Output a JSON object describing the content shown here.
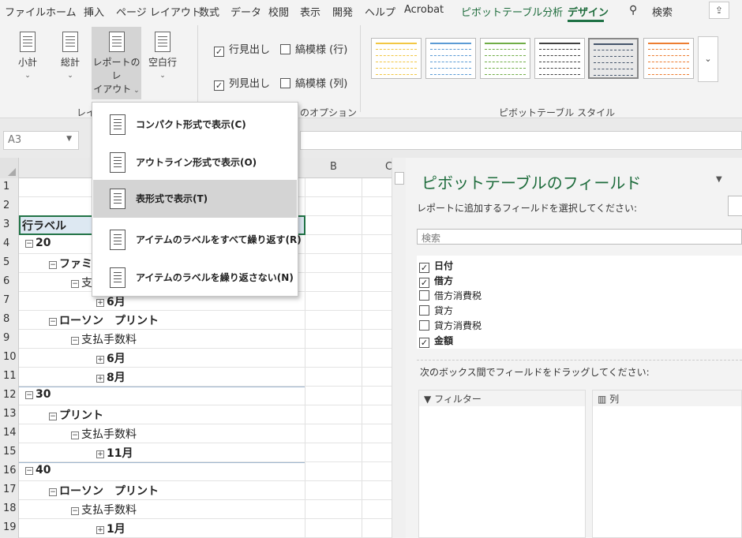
{
  "menubar": {
    "tabs": [
      "ファイル",
      "ホーム",
      "挿入",
      "ページ レイアウト",
      "数式",
      "データ",
      "校閲",
      "表示",
      "開発",
      "ヘルプ",
      "Acrobat",
      "ピボットテーブル分析",
      "デザイン"
    ],
    "search_label": "検索",
    "active_tab": "デザイン"
  },
  "ribbon": {
    "layout_buttons": [
      {
        "label": "小計",
        "label2": ""
      },
      {
        "label": "総計",
        "label2": ""
      },
      {
        "label": "レポートのレ",
        "label2": "イアウト"
      },
      {
        "label": "空白行",
        "label2": ""
      }
    ],
    "group_layout": "レイアウト",
    "options": {
      "row_headers": "行見出し",
      "col_headers": "列見出し",
      "banded_rows": "縞模様 (行)",
      "banded_cols": "縞模様 (列)",
      "group_label": "ピボットテーブル スタイルのオプション",
      "visible_group_label": "のオプション"
    },
    "styles_group": "ピボットテーブル スタイル",
    "style_colors": [
      "#f2c744",
      "#5b9bd5",
      "#70ad47",
      "#404040",
      "#44546a",
      "#ed7d31"
    ]
  },
  "formula": {
    "namebox": "A3"
  },
  "grid": {
    "columns": [
      "B",
      "C"
    ],
    "rows": [
      {
        "n": "1",
        "text": "",
        "indent": 0,
        "bold": false,
        "icon": ""
      },
      {
        "n": "2",
        "text": "",
        "indent": 0,
        "bold": false,
        "icon": ""
      },
      {
        "n": "3",
        "text": "行ラベル",
        "indent": 0,
        "bold": true,
        "icon": "",
        "header": true
      },
      {
        "n": "4",
        "text": "20",
        "indent": 0,
        "bold": true,
        "icon": "−"
      },
      {
        "n": "5",
        "text": "ファミ",
        "indent": 1,
        "bold": true,
        "icon": "−"
      },
      {
        "n": "6",
        "text": "支",
        "indent": 2,
        "bold": false,
        "icon": "−"
      },
      {
        "n": "7",
        "text": "6月",
        "indent": 3,
        "bold": true,
        "icon": "+"
      },
      {
        "n": "8",
        "text": "ローソン　プリント",
        "indent": 1,
        "bold": true,
        "icon": "−"
      },
      {
        "n": "9",
        "text": "支払手数料",
        "indent": 2,
        "bold": false,
        "icon": "−"
      },
      {
        "n": "10",
        "text": "6月",
        "indent": 3,
        "bold": true,
        "icon": "+"
      },
      {
        "n": "11",
        "text": "8月",
        "indent": 3,
        "bold": true,
        "icon": "+"
      },
      {
        "n": "12",
        "text": "30",
        "indent": 0,
        "bold": true,
        "icon": "−"
      },
      {
        "n": "13",
        "text": "プリント",
        "indent": 1,
        "bold": true,
        "icon": "−"
      },
      {
        "n": "14",
        "text": "支払手数料",
        "indent": 2,
        "bold": false,
        "icon": "−"
      },
      {
        "n": "15",
        "text": "11月",
        "indent": 3,
        "bold": true,
        "icon": "+"
      },
      {
        "n": "16",
        "text": "40",
        "indent": 0,
        "bold": true,
        "icon": "−"
      },
      {
        "n": "17",
        "text": "ローソン　プリント",
        "indent": 1,
        "bold": true,
        "icon": "−"
      },
      {
        "n": "18",
        "text": "支払手数料",
        "indent": 2,
        "bold": false,
        "icon": "−"
      },
      {
        "n": "19",
        "text": "1月",
        "indent": 3,
        "bold": true,
        "icon": "+"
      }
    ]
  },
  "dropdown_menu": {
    "items": [
      "コンパクト形式で表示(C)",
      "アウトライン形式で表示(O)",
      "表形式で表示(T)",
      "アイテムのラベルをすべて繰り返す(R)",
      "アイテムのラベルを繰り返さない(N)"
    ],
    "highlighted_index": 2
  },
  "pivot_pane": {
    "title": "ピボットテーブルのフィールド",
    "subtitle": "レポートに追加するフィールドを選択してください:",
    "search_placeholder": "検索",
    "fields": [
      {
        "name": "日付",
        "checked": true
      },
      {
        "name": "借方",
        "checked": true
      },
      {
        "name": "借方消費税",
        "checked": false
      },
      {
        "name": "貸方",
        "checked": false
      },
      {
        "name": "貸方消費税",
        "checked": false
      },
      {
        "name": "金額",
        "checked": true
      }
    ],
    "drag_hint": "次のボックス間でフィールドをドラッグしてください:",
    "areas": [
      "フィルター",
      "列"
    ]
  }
}
